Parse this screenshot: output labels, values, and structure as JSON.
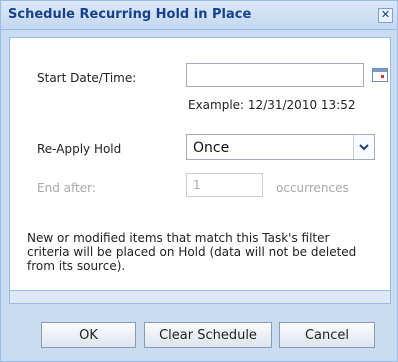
{
  "dialog": {
    "title": "Schedule Recurring Hold in Place",
    "close_label": "✕"
  },
  "form": {
    "start": {
      "label": "Start Date/Time:",
      "value": "",
      "example": "Example: 12/31/2010 13:52"
    },
    "reapply": {
      "label": "Re-Apply Hold",
      "selected": "Once"
    },
    "end_after": {
      "label": "End after:",
      "value": "1",
      "suffix": "occurrences"
    },
    "note": "New or modified items that match this Task's filter criteria will be placed on Hold (data will not be deleted from its source)."
  },
  "buttons": {
    "ok": "OK",
    "clear": "Clear Schedule",
    "cancel": "Cancel"
  },
  "colors": {
    "title": "#15428b",
    "frame": "#c9dcf2",
    "border": "#99bbe8"
  }
}
